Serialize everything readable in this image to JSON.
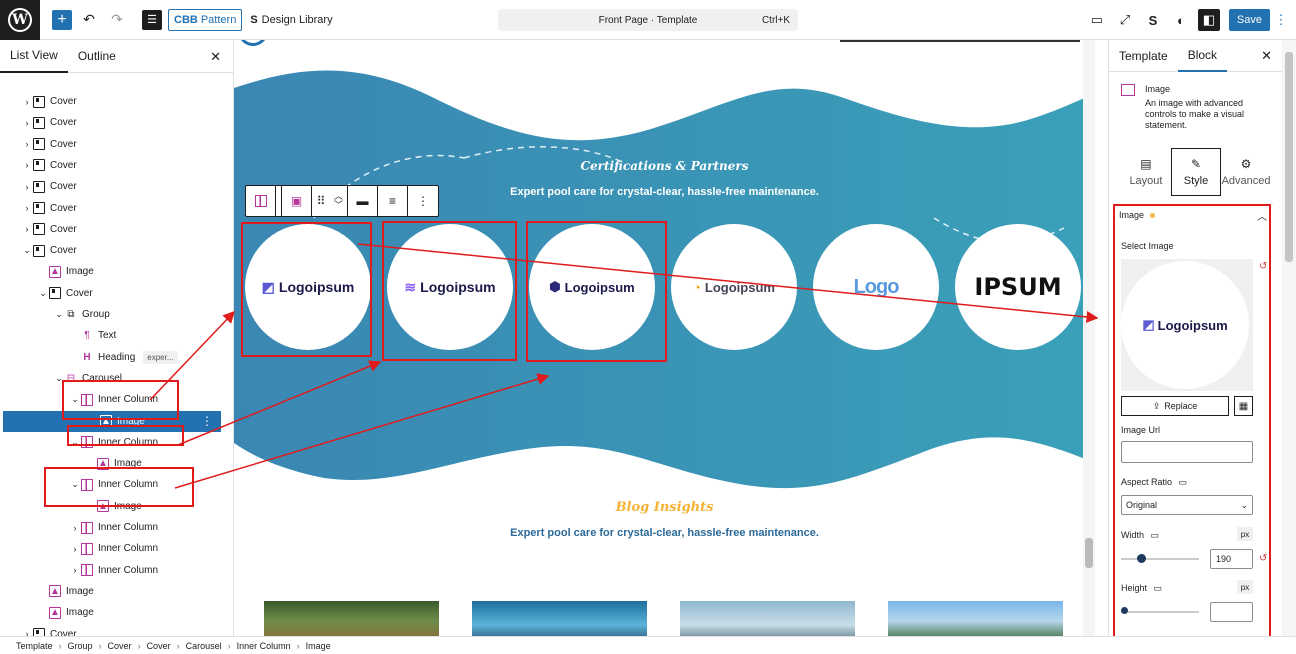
{
  "topbar": {
    "pattern_label": "Pattern",
    "pattern_prefix": "CBB",
    "design_library": "Design Library",
    "document_title": "Front Page · Template",
    "shortcut": "Ctrl+K",
    "save_label": "Save"
  },
  "left_panel": {
    "tabs": [
      "List View",
      "Outline"
    ],
    "rows": [
      {
        "label": "Cover",
        "icon": "cover",
        "indent": 0,
        "chev": "›"
      },
      {
        "label": "Cover",
        "icon": "cover",
        "indent": 0,
        "chev": "›"
      },
      {
        "label": "Cover",
        "icon": "cover",
        "indent": 0,
        "chev": "›"
      },
      {
        "label": "Cover",
        "icon": "cover",
        "indent": 0,
        "chev": "›"
      },
      {
        "label": "Cover",
        "icon": "cover",
        "indent": 0,
        "chev": "›"
      },
      {
        "label": "Cover",
        "icon": "cover",
        "indent": 0,
        "chev": "›"
      },
      {
        "label": "Cover",
        "icon": "cover",
        "indent": 0,
        "chev": "›"
      },
      {
        "label": "Cover",
        "icon": "cover",
        "indent": 0,
        "chev": "⌄"
      },
      {
        "label": "Image",
        "icon": "image",
        "indent": 1,
        "chev": ""
      },
      {
        "label": "Cover",
        "icon": "cover",
        "indent": 1,
        "chev": "⌄"
      },
      {
        "label": "Group",
        "icon": "group",
        "indent": 2,
        "chev": "⌄"
      },
      {
        "label": "Text",
        "icon": "text",
        "indent": 3,
        "chev": ""
      },
      {
        "label": "Heading",
        "icon": "heading",
        "indent": 3,
        "chev": "",
        "badge": "exper..."
      },
      {
        "label": "Carousel",
        "icon": "carousel",
        "indent": 2,
        "chev": "⌄"
      },
      {
        "label": "Inner Column",
        "icon": "col",
        "indent": 3,
        "chev": "⌄"
      },
      {
        "label": "Image",
        "icon": "image",
        "indent": 4,
        "chev": "",
        "selected": true
      },
      {
        "label": "Inner Column",
        "icon": "col",
        "indent": 3,
        "chev": "⌄"
      },
      {
        "label": "Image",
        "icon": "image",
        "indent": 4,
        "chev": ""
      },
      {
        "label": "Inner Column",
        "icon": "col",
        "indent": 3,
        "chev": "⌄"
      },
      {
        "label": "Image",
        "icon": "image",
        "indent": 4,
        "chev": ""
      },
      {
        "label": "Inner Column",
        "icon": "col",
        "indent": 3,
        "chev": "›"
      },
      {
        "label": "Inner Column",
        "icon": "col",
        "indent": 3,
        "chev": "›"
      },
      {
        "label": "Inner Column",
        "icon": "col",
        "indent": 3,
        "chev": "›"
      },
      {
        "label": "Image",
        "icon": "image",
        "indent": 1,
        "chev": ""
      },
      {
        "label": "Image",
        "icon": "image",
        "indent": 1,
        "chev": ""
      },
      {
        "label": "Cover",
        "icon": "cover",
        "indent": 0,
        "chev": "›"
      }
    ]
  },
  "canvas": {
    "cert_title": "Certifications & Partners",
    "cert_sub": "Expert pool care for crystal-clear, hassle-free maintenance.",
    "logos": [
      "Logoipsum",
      "Logoipsum",
      "Logoipsum",
      "Logoipsum",
      "Logo",
      "IPSUM"
    ],
    "blog_title": "Blog Insights",
    "blog_sub": "Expert pool care for crystal-clear, hassle-free maintenance.",
    "colors": {
      "wave": "#3a8fb5",
      "title_orange": "#f5b335",
      "sub_blue": "#2b6a99"
    }
  },
  "right_panel": {
    "tabs": [
      "Template",
      "Block"
    ],
    "block_name": "Image",
    "block_desc": "An image with advanced controls to make a visual statement.",
    "subtabs": [
      "Layout",
      "Style",
      "Advanced"
    ],
    "section_title": "Image",
    "select_image": "Select Image",
    "preview_logo": "Logoipsum",
    "replace": "Replace",
    "image_url_label": "Image Url",
    "image_url_value": "",
    "aspect_ratio_label": "Aspect Ratio",
    "aspect_ratio_value": "Original",
    "width_label": "Width",
    "width_unit": "px",
    "width_value": "190",
    "width_fraction": 0.2,
    "height_label": "Height",
    "height_unit": "px",
    "height_value": "",
    "height_fraction": 0
  },
  "breadcrumb": [
    "Template",
    "Group",
    "Cover",
    "Cover",
    "Carousel",
    "Inner Column",
    "Image"
  ]
}
